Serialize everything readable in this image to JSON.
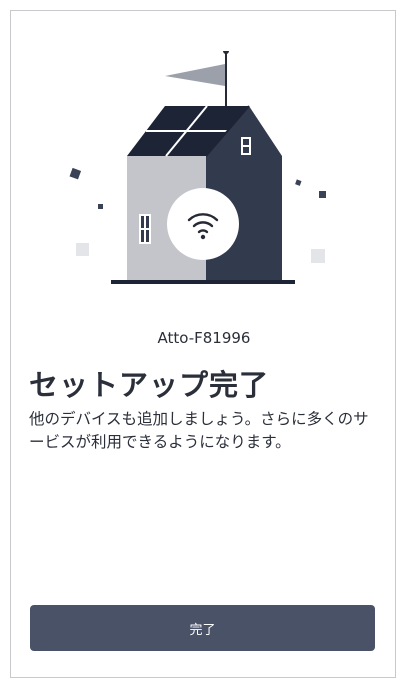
{
  "device": {
    "name": "Atto-F81996"
  },
  "content": {
    "title": "セットアップ完了",
    "description": "他のデバイスも追加しましょう。さらに多くのサービスが利用できるようになります。"
  },
  "actions": {
    "done_label": "完了"
  },
  "illustration": {
    "icon": "house-wifi-illustration",
    "colors": {
      "roof": "#1c2436",
      "house_dark": "#323a4d",
      "house_light": "#c3c5cb",
      "flag": "#9ca0aa",
      "confetti_dark": "#3a4256",
      "confetti_light": "#e4e5e8"
    }
  },
  "colors": {
    "accent": "#4a5268",
    "text": "#2b2f3a",
    "frame_border": "#c8c9cc"
  }
}
